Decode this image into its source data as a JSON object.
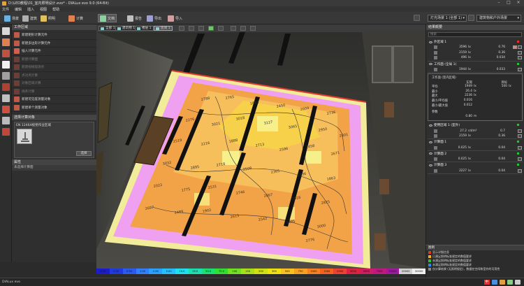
{
  "window": {
    "title": "D:\\LED教程\\01_室内照明设计.evo* - DIALux evo 9.0 (64-Bit)"
  },
  "menu": [
    "文件",
    "编辑",
    "插入",
    "视图",
    "帮助"
  ],
  "toolbar": {
    "items": [
      "场景",
      "建筑",
      "照明",
      "计算",
      "文档",
      "报告",
      "导出",
      "导入"
    ],
    "active_index": 4,
    "select_left": "灯光场景 1 (全部 1)",
    "select_right": "建筑物和户外场景"
  },
  "left_panel": {
    "header": "工作区域",
    "tools": [
      {
        "label": "新建矩形计算元件",
        "disabled": false
      },
      {
        "label": "新建多边形计算元件",
        "disabled": false
      },
      {
        "label": "插入计算元件",
        "disabled": false
      },
      {
        "label": "新建计算面",
        "disabled": true
      },
      {
        "label": "新建视线观测点",
        "disabled": true
      },
      {
        "label": "点对点计算",
        "disabled": true
      },
      {
        "label": "对象区域计算",
        "disabled": true
      },
      {
        "label": "线条计算",
        "disabled": true
      },
      {
        "label": "新建可见度测量对象",
        "disabled": false
      },
      {
        "label": "新建单个测量对象",
        "disabled": false
      }
    ],
    "object_section": "选择计算对象",
    "object_label": "EN 12464视觉作业区域",
    "object_button": "选择",
    "props_header": "属性",
    "props_item": "未选择计算面"
  },
  "view_tabs": [
    "全部 1",
    "建筑物 1",
    "楼层 1",
    "房间 1"
  ],
  "scene": {
    "contour_labels": [
      "2788",
      "2765",
      "1843",
      "2450",
      "2604",
      "2736",
      "2276",
      "3021",
      "3018",
      "3127",
      "3065",
      "2950",
      "2801",
      "2519",
      "2216",
      "1888",
      "2713",
      "2596",
      "2458",
      "2671",
      "3032",
      "2895",
      "2718",
      "2508",
      "2365",
      "2136",
      "1863",
      "2022",
      "1775",
      "2531",
      "2746",
      "2867",
      "2918",
      "2825",
      "2697",
      "2489",
      "1902",
      "2615",
      "2542",
      "2405",
      "3000",
      "2776"
    ]
  },
  "scale_bar": {
    "values": [
      "0.10",
      "0.20",
      "0.50",
      "1.00",
      "2.00",
      "5.00",
      "10.0",
      "20.0",
      "50.0",
      "75.0",
      "100",
      "150",
      "200",
      "300",
      "500",
      "750",
      "1000",
      "1500",
      "2000",
      "3000",
      "5000",
      "7500",
      "10000",
      "20000",
      "50000"
    ],
    "colors": [
      "#1b1bd0",
      "#1f3be0",
      "#2a5af0",
      "#2f7fff",
      "#2aa0ff",
      "#23c0ff",
      "#1ee0f0",
      "#19e0b0",
      "#1ae070",
      "#30e030",
      "#70e020",
      "#a8e018",
      "#d0e010",
      "#f0e010",
      "#f8c020",
      "#f8a020",
      "#f88020",
      "#f86020",
      "#f04030",
      "#e02040",
      "#d01c60",
      "#c01880",
      "#a018a0",
      "#d0d0d0",
      "#f0f0f0"
    ]
  },
  "right_panel": {
    "header": "结果概要",
    "search_placeholder": "搜索",
    "groups": [
      {
        "title": "外区域 1",
        "status_color": "#d83a2a",
        "rows": [
          {
            "value": "3596",
            "unit": "lx",
            "value2": "0.76"
          },
          {
            "value": "2159",
            "unit": "lx",
            "value2": "0.36"
          },
          {
            "value": "496",
            "unit": "lx",
            "value2": "0.034"
          }
        ]
      },
      {
        "title": "工作面 (全局 1)",
        "status_color": "#2ec23a",
        "rows": [
          {
            "value": "1944",
            "unit": "lx",
            "value2": "0.033"
          }
        ]
      }
    ],
    "detail": {
      "title": "工作面 (室内区域)",
      "col_actual": "实际",
      "col_target": "目标",
      "rows": [
        {
          "label": "平均",
          "value": "1949",
          "unit": "lx",
          "value2": "500",
          "unit2": "lx"
        },
        {
          "label": "最小",
          "value": "26.4",
          "unit": "lx",
          "value2": "",
          "unit2": ""
        },
        {
          "label": "最大",
          "value": "2236",
          "unit": "lx",
          "value2": "",
          "unit2": ""
        },
        {
          "label": "最小/平均值",
          "value": "0.016",
          "unit": "",
          "value2": "",
          "unit2": ""
        },
        {
          "label": "最小/最大值",
          "value": "0.012",
          "unit": "",
          "value2": "",
          "unit2": ""
        }
      ],
      "param_label": "参数",
      "param_value": "0.80",
      "param_unit": "m"
    },
    "groups2": [
      {
        "title": "使用区域 1 (室外)",
        "status_color": "#2ec23a",
        "rows": [
          {
            "value": "27.2",
            "unit": "cd/m²",
            "value2": "0.7"
          },
          {
            "value": "2159",
            "unit": "lx",
            "value2": "0.36"
          }
        ]
      },
      {
        "title": "计算面 1",
        "status_color": "#2ec23a",
        "rows": [
          {
            "value": "0.025",
            "unit": "lx",
            "value2": "0.04"
          }
        ]
      },
      {
        "title": "计算面 2",
        "status_color": "#2ec23a",
        "rows": [
          {
            "value": "0.025",
            "unit": "lx",
            "value2": "0.04"
          }
        ]
      },
      {
        "title": "计算面 3",
        "status_color": "#2ec23a",
        "rows": [
          {
            "value": "2227",
            "unit": "lx",
            "value2": "0.04"
          }
        ]
      }
    ]
  },
  "legend": {
    "header": "图例",
    "rows": [
      {
        "color": "#d83a2a",
        "label": "显示详细信息"
      },
      {
        "color": "#f0b020",
        "label": "已满足照明标准规定的数值要求"
      },
      {
        "color": "#2ec23a",
        "label": "未满足照明标准规定的数值要求"
      },
      {
        "color": "#2a8af0",
        "label": "未满足照明标准规定的数值要求"
      },
      {
        "color": "#888888",
        "label": "仅计算结果 (无照明规定)，数据在空间和室外的可用性"
      }
    ]
  },
  "statusbar": {
    "text": "DIALux evo",
    "ime": "中"
  }
}
